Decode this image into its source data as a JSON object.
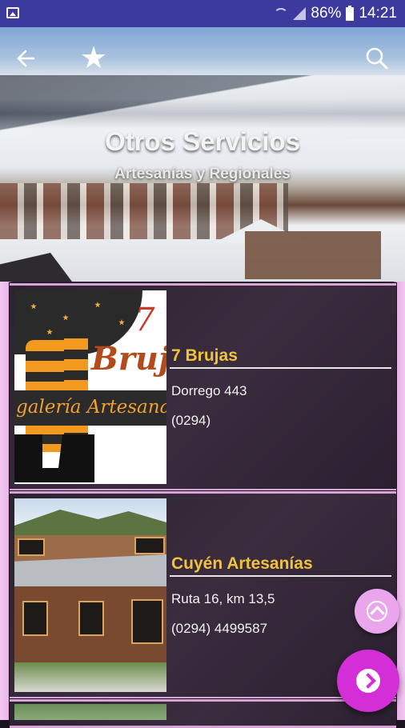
{
  "status_bar": {
    "battery_percent": "86%",
    "time": "14:21"
  },
  "header": {
    "title": "Otros Servicios",
    "subtitle": "Artesanías y Regionales"
  },
  "icons": {
    "back": "arrow-left-icon",
    "favorite": "star-icon",
    "search": "search-icon"
  },
  "thumbnails": {
    "brujas": {
      "number": "7",
      "word": "Brujas",
      "gallery": "galería Artesanal"
    }
  },
  "items": [
    {
      "name": "7 Brujas",
      "address": "Dorrego 443",
      "phone": "(0294)"
    },
    {
      "name": "Cuyén Artesanías",
      "address": "Ruta 16, km 13,5",
      "phone": "(0294) 4499587"
    }
  ],
  "colors": {
    "status_bar": "#3d3a9e",
    "accent_name": "#f0c33c",
    "fab_primary": "#d42fd6",
    "fab_secondary": "#e9a6ec"
  }
}
